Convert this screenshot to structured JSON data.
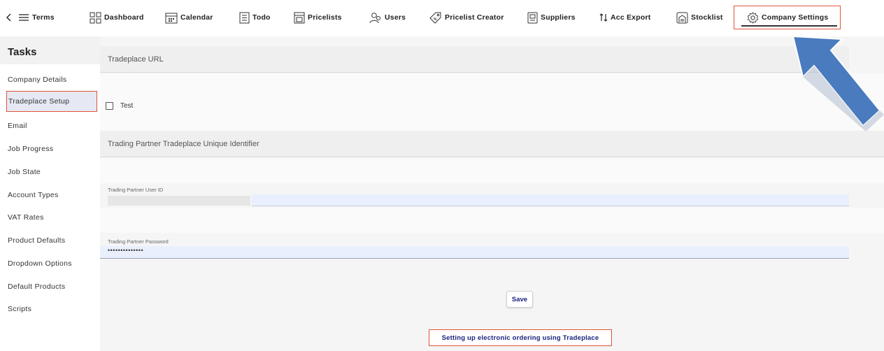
{
  "nav": {
    "terms": "Terms",
    "dashboard": "Dashboard",
    "calendar": "Calendar",
    "todo": "Todo",
    "pricelists": "Pricelists",
    "users": "Users",
    "pricelist_creator": "Pricelist Creator",
    "suppliers": "Suppliers",
    "acc_export": "Acc Export",
    "stocklist": "Stocklist",
    "company_settings": "Company Settings",
    "active_tab": "Company Settings"
  },
  "sidebar": {
    "title": "Tasks",
    "items": [
      {
        "label": "Company Details"
      },
      {
        "label": "Tradeplace Setup"
      },
      {
        "label": "Email"
      },
      {
        "label": "Job Progress"
      },
      {
        "label": "Job State"
      },
      {
        "label": "Account Types"
      },
      {
        "label": "VAT Rates"
      },
      {
        "label": "Product Defaults"
      },
      {
        "label": "Dropdown Options"
      },
      {
        "label": "Default Products"
      },
      {
        "label": "Scripts"
      }
    ],
    "active_item": "Tradeplace Setup"
  },
  "main": {
    "section_url": "Tradeplace URL",
    "test_label": "Test",
    "test_checked": false,
    "section_identifier": "Trading Partner Tradeplace Unique Identifier",
    "user_id_label": "Trading Partner User ID",
    "user_id_value": "",
    "password_label": "Trading Partner Password",
    "password_value": "••••••••••••••",
    "save_label": "Save",
    "help_link": "Setting up electronic ordering using Tradeplace"
  },
  "colors": {
    "highlight_border": "#e0553a",
    "arrow_fill": "#4a7bbf",
    "link_text": "#1a237e",
    "active_bg": "#e6e9f4"
  }
}
